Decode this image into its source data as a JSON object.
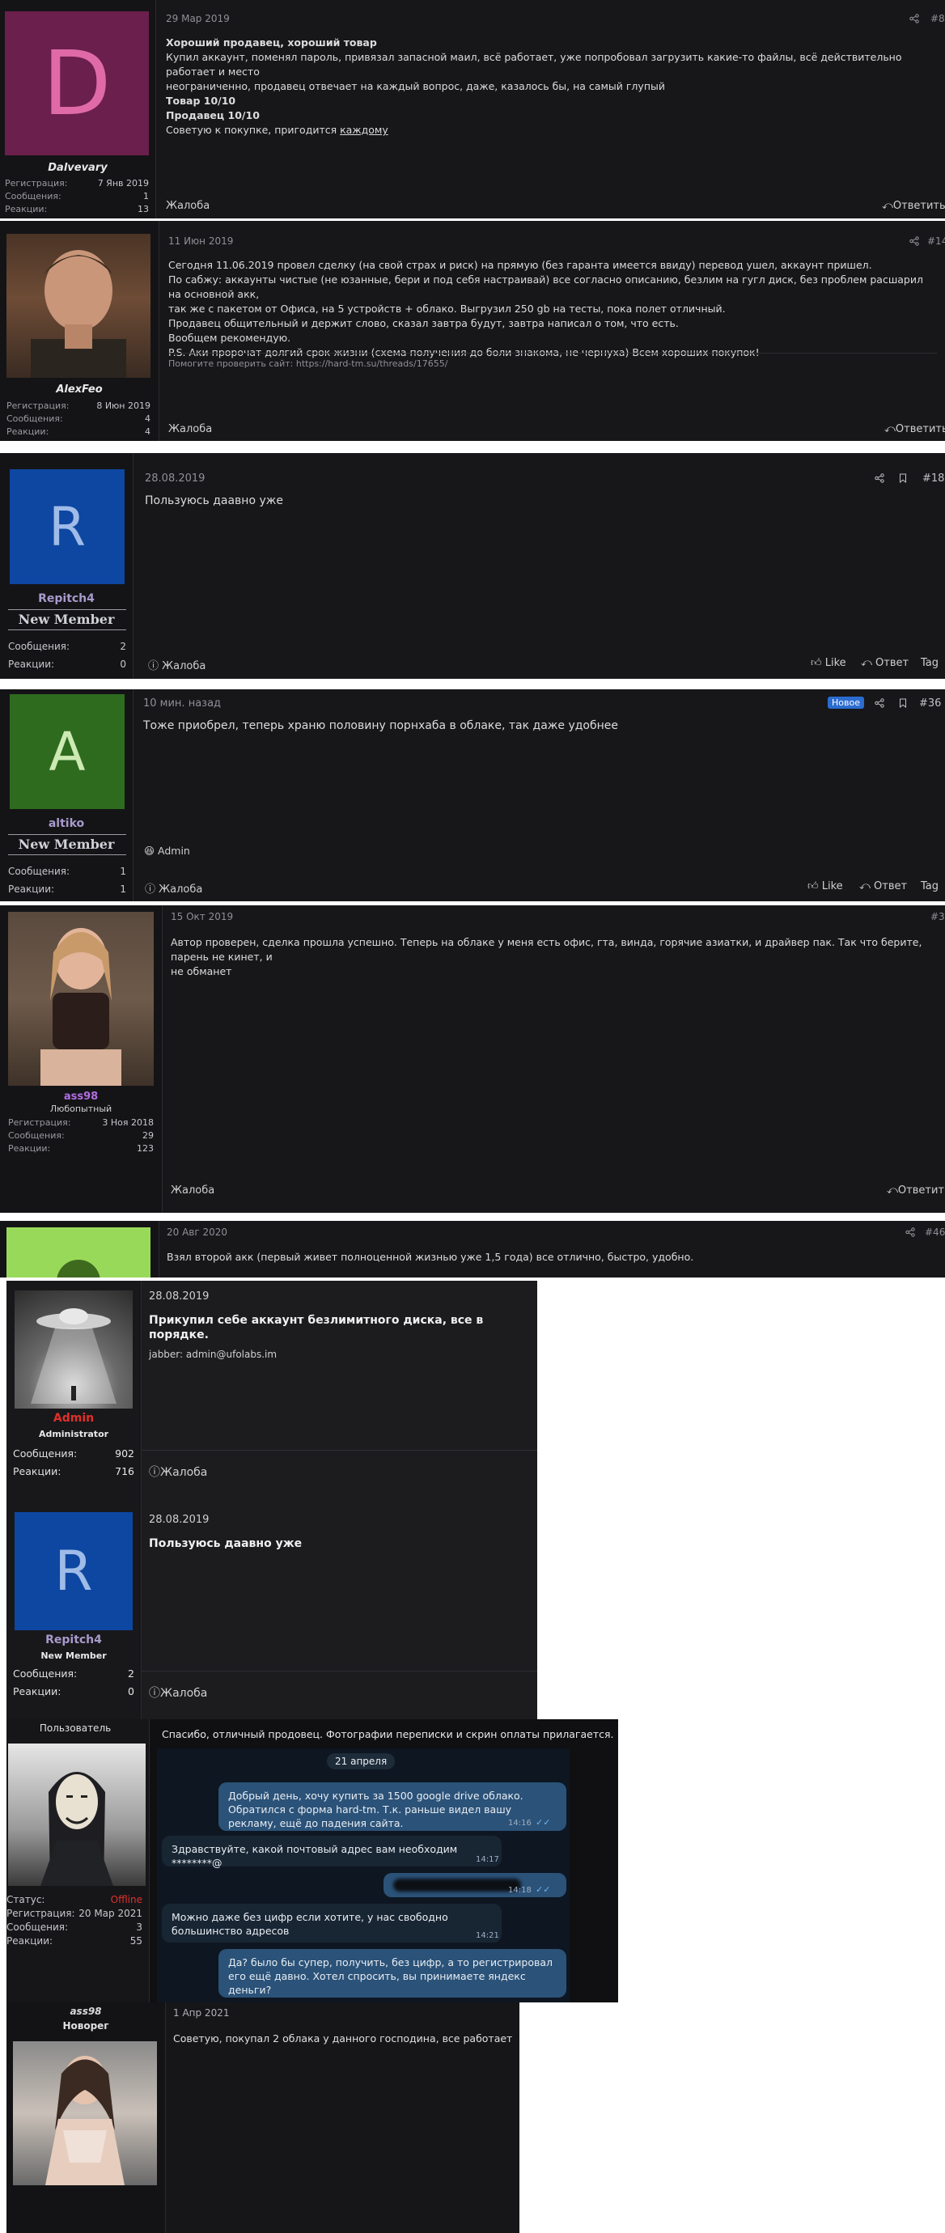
{
  "posts": [
    {
      "date": "29 Мар 2019",
      "num": "#8",
      "author": "Dalvevary",
      "avatar_letter": "D",
      "stats": [
        {
          "label": "Регистрация:",
          "value": "7 Янв 2019"
        },
        {
          "label": "Сообщения:",
          "value": "1"
        },
        {
          "label": "Реакции:",
          "value": "13"
        }
      ],
      "title": "Хороший продавец, хороший товар",
      "lines": [
        "Купил аккаунт, поменял пароль, привязал запасной маил, всё работает, уже попробовал загрузить какие-то файлы, всё действительно работает и место",
        "неограниченно, продавец отвечает на каждый вопрос, даже, казалось бы, на самый глупый"
      ],
      "bold_lines": [
        "Товар 10/10",
        "Продавец 10/10"
      ],
      "last_line_prefix": "Советую к покупке, пригодится ",
      "last_line_link": "каждому",
      "report": "Жалоба",
      "reply": "Ответить"
    },
    {
      "date": "11 Июн 2019",
      "num": "#14",
      "author": "AlexFeo",
      "stats": [
        {
          "label": "Регистрация:",
          "value": "8 Июн 2019"
        },
        {
          "label": "Сообщения:",
          "value": "4"
        },
        {
          "label": "Реакции:",
          "value": "4"
        }
      ],
      "lines": [
        "Сегодня 11.06.2019 провел сделку (на свой страх и риск) на прямую (без гаранта имеется ввиду) перевод ушел, аккаунт пришел.",
        "По сабжу: аккаунты чистые (не юзанные, бери и под себя настраивай) все согласно описанию, безлим на гугл диск, без проблем расшарил на основной акк,",
        "так же с пакетом от Офиса, на 5 устройств + облако. Выгрузил 250 gb на тесты, пока полет отличный.",
        "Продавец общительный и держит слово, сказал завтра будут, завтра написал о том, что есть.",
        "Вообщем рекомендую.",
        "P.S. Аки пророчат долгий срок жизни (схема получения до боли знакома, не чернуха) Всем хороших покупок!"
      ],
      "signature": "Помогите проверить сайт: https://hard-tm.su/threads/17655/",
      "report": "Жалоба",
      "reply": "Ответить"
    },
    {
      "date": "28.08.2019",
      "num": "#18",
      "author": "Repitch4",
      "avatar_letter": "R",
      "rank": "New Member",
      "stats": [
        {
          "label": "Сообщения:",
          "value": "2"
        },
        {
          "label": "Реакции:",
          "value": "0"
        }
      ],
      "text": "Пользуюсь даавно уже",
      "report": "Жалоба",
      "like": "Like",
      "reply": "Ответ",
      "tag": "Tag"
    },
    {
      "date": "10 мин. назад",
      "badge": "Новое",
      "num": "#36",
      "author": "altiko",
      "avatar_letter": "A",
      "rank": "New Member",
      "stats": [
        {
          "label": "Сообщения:",
          "value": "1"
        },
        {
          "label": "Реакции:",
          "value": "1"
        }
      ],
      "text": "Тоже приобрел, теперь храню половину порнхаба в облаке, так даже удобнее",
      "reaction_user": "Admin",
      "report": "Жалоба",
      "like": "Like",
      "reply": "Ответ",
      "tag": "Tag"
    },
    {
      "date": "15 Окт 2019",
      "num": "#3",
      "author": "ass98",
      "rank": "Любопытный",
      "stats": [
        {
          "label": "Регистрация:",
          "value": "3 Ноя 2018"
        },
        {
          "label": "Сообщения:",
          "value": "29"
        },
        {
          "label": "Реакции:",
          "value": "123"
        }
      ],
      "lines": [
        "Автор проверен, сделка прошла успешно. Теперь на облаке у меня есть офис, гта, винда, горячие азиатки, и драйвер пак. Так что берите, парень не кинет, и",
        "не обманет"
      ],
      "report": "Жалоба",
      "reply": "Ответить"
    },
    {
      "date": "20 Авг 2020",
      "num": "#46",
      "text": "Взял второй акк (первый живет полноценной жизнью уже 1,5 года) все отлично, быстро, удобно."
    },
    {
      "date": "28.08.2019",
      "author": "Admin",
      "rank": "Administrator",
      "stats": [
        {
          "label": "Сообщения:",
          "value": "902"
        },
        {
          "label": "Реакции:",
          "value": "716"
        }
      ],
      "text": "Прикупил себе аккаунт безлимитного диска, все в порядке.",
      "signature": "jabber: admin@ufolabs.im",
      "report": "Жалоба"
    },
    {
      "date": "28.08.2019",
      "author": "Repitch4",
      "avatar_letter": "R",
      "rank": "New Member",
      "stats": [
        {
          "label": "Сообщения:",
          "value": "2"
        },
        {
          "label": "Реакции:",
          "value": "0"
        }
      ],
      "text": "Пользуюсь даавно уже",
      "report": "Жалоба"
    },
    {
      "header": "Пользователь",
      "stats": [
        {
          "label": "Статус:",
          "value": "Offline"
        },
        {
          "label": "Регистрация:",
          "value": "20 Мар 2021"
        },
        {
          "label": "Сообщения:",
          "value": "3"
        },
        {
          "label": "Реакции:",
          "value": "55"
        }
      ],
      "text": "Спасибо, отличный продовец. Фотографии переписки и скрин оплаты прилагается.",
      "chat": {
        "day": "21 апреля",
        "messages": [
          {
            "text": "Добрый день, хочу купить за 1500 google drive облако. Обратился с форма hard-tm. Т.к. раньше видел вашу рекламу, ещё до падения сайта.",
            "time": "14:16"
          },
          {
            "text": "Здравствуйте, какой почтовый адрес вам необходим ********@",
            "time": "14:17"
          },
          {
            "text": "",
            "time": "14:18"
          },
          {
            "text": "Можно даже без цифр если хотите, у нас свободно большинство адресов",
            "time": "14:21"
          },
          {
            "text": "Да? было бы супер, получить, без цифр, а то регистрировал его ещё давно. Хотел спросить, вы принимаете яндекс деньги?",
            "time": ""
          }
        ]
      }
    },
    {
      "date": "1 Апр 2021",
      "author": "ass98",
      "rank": "Новорег",
      "text": "Советую, покупал 2 облака у данного господина, все работает"
    }
  ],
  "colors": {
    "post_bg": "#17171a",
    "avatar_d": "#6b1f4c",
    "avatar_d_letter": "#e06aa8",
    "avatar_r": "#0d47a1",
    "avatar_a": "#2e6b1e",
    "avatar_s": "#99d95a",
    "link_blue": "#4a8fd8",
    "admin_red": "#e0302a",
    "offline_red": "#e0302a",
    "rank_purple": "#a89acb",
    "badge_blue": "#2b6cd0",
    "chat_out": "#2b5278",
    "chat_in": "#182533"
  }
}
